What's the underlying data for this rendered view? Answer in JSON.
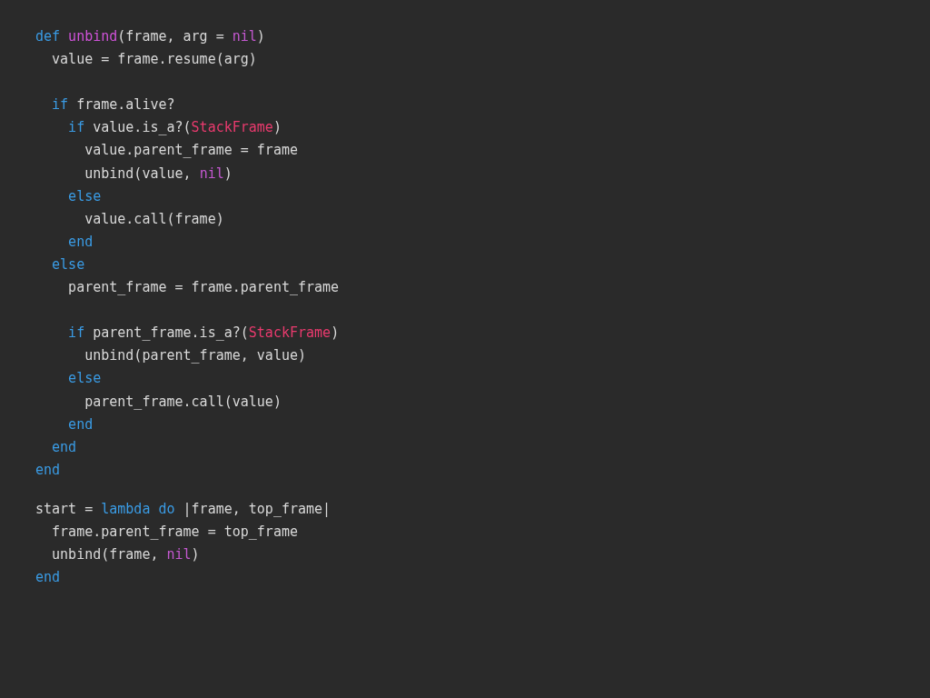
{
  "blocks": [
    {
      "lines": [
        {
          "kind": "code",
          "tokens": [
            {
              "text": "def",
              "kind": "keyword"
            },
            {
              "text": " unbind",
              "kind": "function"
            },
            {
              "text": "(frame, arg = ",
              "kind": "plain"
            },
            {
              "text": "nil",
              "kind": "nil"
            },
            {
              "text": ")",
              "kind": "plain"
            }
          ]
        },
        {
          "kind": "code",
          "tokens": [
            {
              "text": "  value = frame.resume(arg)",
              "kind": "plain"
            }
          ]
        },
        {
          "kind": "blank"
        },
        {
          "kind": "code",
          "tokens": [
            {
              "text": "  if",
              "kind": "keyword"
            },
            {
              "text": " frame.alive?",
              "kind": "plain"
            }
          ]
        },
        {
          "kind": "code",
          "tokens": [
            {
              "text": "    if",
              "kind": "keyword"
            },
            {
              "text": " value.is_a?(",
              "kind": "plain"
            },
            {
              "text": "StackFrame",
              "kind": "constant"
            },
            {
              "text": ")",
              "kind": "plain"
            }
          ]
        },
        {
          "kind": "code",
          "tokens": [
            {
              "text": "      value.parent_frame = frame",
              "kind": "plain"
            }
          ]
        },
        {
          "kind": "code",
          "tokens": [
            {
              "text": "      unbind(value, ",
              "kind": "plain"
            },
            {
              "text": "nil",
              "kind": "nil"
            },
            {
              "text": ")",
              "kind": "plain"
            }
          ]
        },
        {
          "kind": "code",
          "tokens": [
            {
              "text": "    else",
              "kind": "keyword"
            }
          ]
        },
        {
          "kind": "code",
          "tokens": [
            {
              "text": "      value.call(frame)",
              "kind": "plain"
            }
          ]
        },
        {
          "kind": "code",
          "tokens": [
            {
              "text": "    end",
              "kind": "keyword"
            }
          ]
        },
        {
          "kind": "code",
          "tokens": [
            {
              "text": "  else",
              "kind": "keyword"
            }
          ]
        },
        {
          "kind": "code",
          "tokens": [
            {
              "text": "    parent_frame = frame.parent_frame",
              "kind": "plain"
            }
          ]
        },
        {
          "kind": "blank"
        },
        {
          "kind": "code",
          "tokens": [
            {
              "text": "    if",
              "kind": "keyword"
            },
            {
              "text": " parent_frame.is_a?(",
              "kind": "plain"
            },
            {
              "text": "StackFrame",
              "kind": "constant"
            },
            {
              "text": ")",
              "kind": "plain"
            }
          ]
        },
        {
          "kind": "code",
          "tokens": [
            {
              "text": "      unbind(parent_frame, value)",
              "kind": "plain"
            }
          ]
        },
        {
          "kind": "code",
          "tokens": [
            {
              "text": "    else",
              "kind": "keyword"
            }
          ]
        },
        {
          "kind": "code",
          "tokens": [
            {
              "text": "      parent_frame.call(value)",
              "kind": "plain"
            }
          ]
        },
        {
          "kind": "code",
          "tokens": [
            {
              "text": "    end",
              "kind": "keyword"
            }
          ]
        },
        {
          "kind": "code",
          "tokens": [
            {
              "text": "  end",
              "kind": "keyword"
            }
          ]
        },
        {
          "kind": "code",
          "tokens": [
            {
              "text": "end",
              "kind": "keyword"
            }
          ]
        }
      ]
    },
    {
      "lines": [
        {
          "kind": "code",
          "tokens": [
            {
              "text": "start = ",
              "kind": "plain"
            },
            {
              "text": "lambda",
              "kind": "keyword"
            },
            {
              "text": " do",
              "kind": "keyword"
            },
            {
              "text": " |frame, top_frame|",
              "kind": "plain"
            }
          ]
        },
        {
          "kind": "code",
          "tokens": [
            {
              "text": "  frame.parent_frame = top_frame",
              "kind": "plain"
            }
          ]
        },
        {
          "kind": "code",
          "tokens": [
            {
              "text": "  unbind(frame, ",
              "kind": "plain"
            },
            {
              "text": "nil",
              "kind": "nil"
            },
            {
              "text": ")",
              "kind": "plain"
            }
          ]
        },
        {
          "kind": "code",
          "tokens": [
            {
              "text": "end",
              "kind": "keyword"
            }
          ]
        }
      ]
    }
  ]
}
